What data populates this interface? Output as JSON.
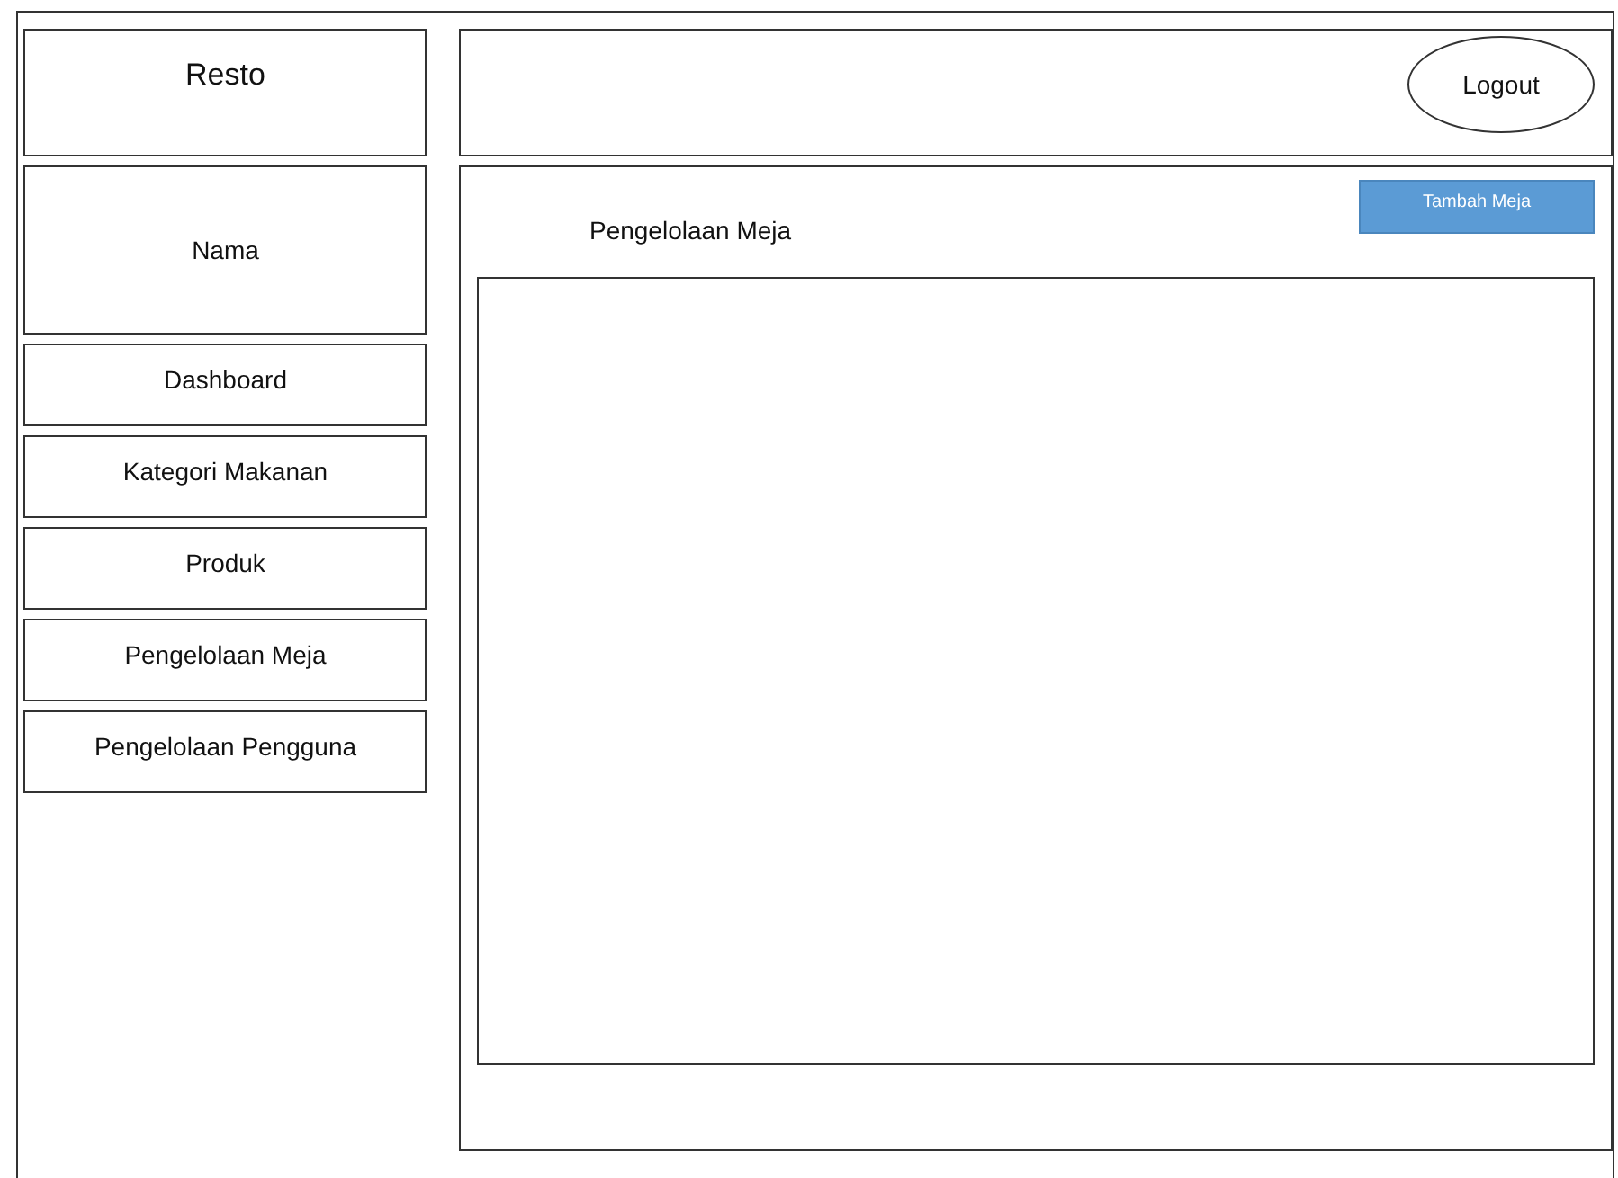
{
  "sidebar": {
    "brand": "Resto",
    "user_name": "Nama",
    "items": [
      {
        "label": "Dashboard"
      },
      {
        "label": "Kategori Makanan"
      },
      {
        "label": "Produk"
      },
      {
        "label": "Pengelolaan Meja"
      },
      {
        "label": "Pengelolaan Pengguna"
      }
    ]
  },
  "header": {
    "logout": "Logout"
  },
  "content": {
    "title": "Pengelolaan Meja",
    "add_button": "Tambah Meja"
  }
}
